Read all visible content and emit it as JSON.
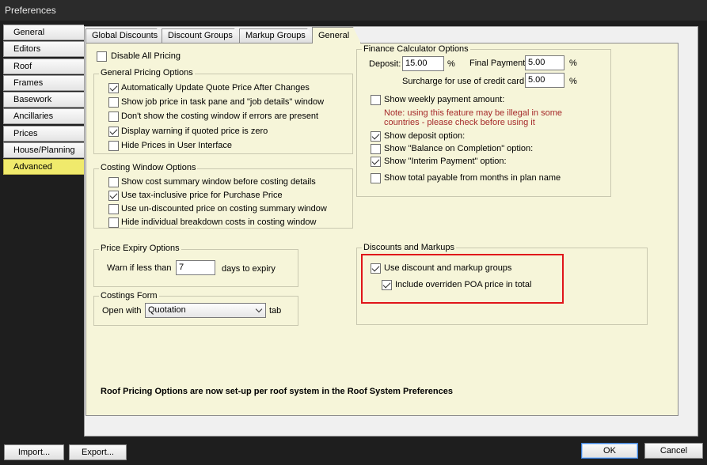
{
  "window": {
    "title": "Preferences"
  },
  "sidebar": {
    "items": [
      {
        "label": "General"
      },
      {
        "label": "Editors"
      },
      {
        "label": "Roof"
      },
      {
        "label": "Frames"
      },
      {
        "label": "Basework"
      },
      {
        "label": "Ancillaries"
      },
      {
        "label": "Prices"
      },
      {
        "label": "House/Planning"
      },
      {
        "label": "Advanced"
      }
    ],
    "selected": "Advanced",
    "selected_color": "#f0ea6c"
  },
  "tabs": [
    {
      "label": "Global Discounts"
    },
    {
      "label": "Discount Groups"
    },
    {
      "label": "Markup Groups"
    },
    {
      "label": "General"
    }
  ],
  "active_tab": "General",
  "general": {
    "disable_all_pricing": {
      "label": "Disable All Pricing",
      "checked": false
    },
    "general_pricing": {
      "title": "General Pricing Options",
      "options": [
        {
          "label": "Automatically Update Quote Price After Changes",
          "checked": true
        },
        {
          "label": "Show job price in task pane and \"job details\" window",
          "checked": false
        },
        {
          "label": "Don't show the costing window if errors are present",
          "checked": false
        },
        {
          "label": "Display warning if quoted price is zero",
          "checked": true
        },
        {
          "label": "Hide Prices in User Interface",
          "checked": false
        }
      ]
    },
    "costing_window": {
      "title": "Costing Window Options",
      "options": [
        {
          "label": "Show cost summary window before costing details",
          "checked": false
        },
        {
          "label": "Use tax-inclusive price for Purchase Price",
          "checked": true
        },
        {
          "label": "Use un-discounted price on costing summary window",
          "checked": false
        },
        {
          "label": "Hide individual breakdown costs in costing window",
          "checked": false
        }
      ]
    },
    "price_expiry": {
      "title": "Price Expiry Options",
      "warn_label": "Warn if less than",
      "days_value": "7",
      "days_suffix": "days to expiry"
    },
    "costings_form": {
      "title": "Costings Form",
      "open_with_label": "Open with",
      "selected": "Quotation",
      "suffix": "tab"
    },
    "finance": {
      "title": "Finance Calculator Options",
      "deposit_label": "Deposit:",
      "deposit_value": "15.00",
      "deposit_unit": "%",
      "final_payment_label": "Final Payment:",
      "final_payment_value": "5.00",
      "final_payment_unit": "%",
      "surcharge_label": "Surcharge for use of credit card:",
      "surcharge_value": "5.00",
      "surcharge_unit": "%",
      "weekly": {
        "label": "Show weekly payment amount:",
        "checked": false
      },
      "note_line1": "Note: using this feature may be illegal in some",
      "note_line2": "countries - please check before using it",
      "note_color": "#a52a2a",
      "options": [
        {
          "label": "Show deposit option:",
          "checked": true
        },
        {
          "label": "Show \"Balance on Completion\" option:",
          "checked": false
        },
        {
          "label": "Show \"Interim Payment\" option:",
          "checked": true
        },
        {
          "label": "Show total payable from months in plan name",
          "checked": false
        }
      ]
    },
    "discounts_markups": {
      "title": "Discounts and Markups",
      "use_groups": {
        "label": "Use discount and markup groups",
        "checked": true
      },
      "include_poa": {
        "label": "Include overriden POA price in total",
        "checked": true
      },
      "highlight_color": "#e0151a"
    },
    "roof_note": "Roof Pricing Options are now set-up per roof system in the Roof System Preferences"
  },
  "footer": {
    "import_label": "Import...",
    "export_label": "Export...",
    "ok_label": "OK",
    "cancel_label": "Cancel"
  }
}
